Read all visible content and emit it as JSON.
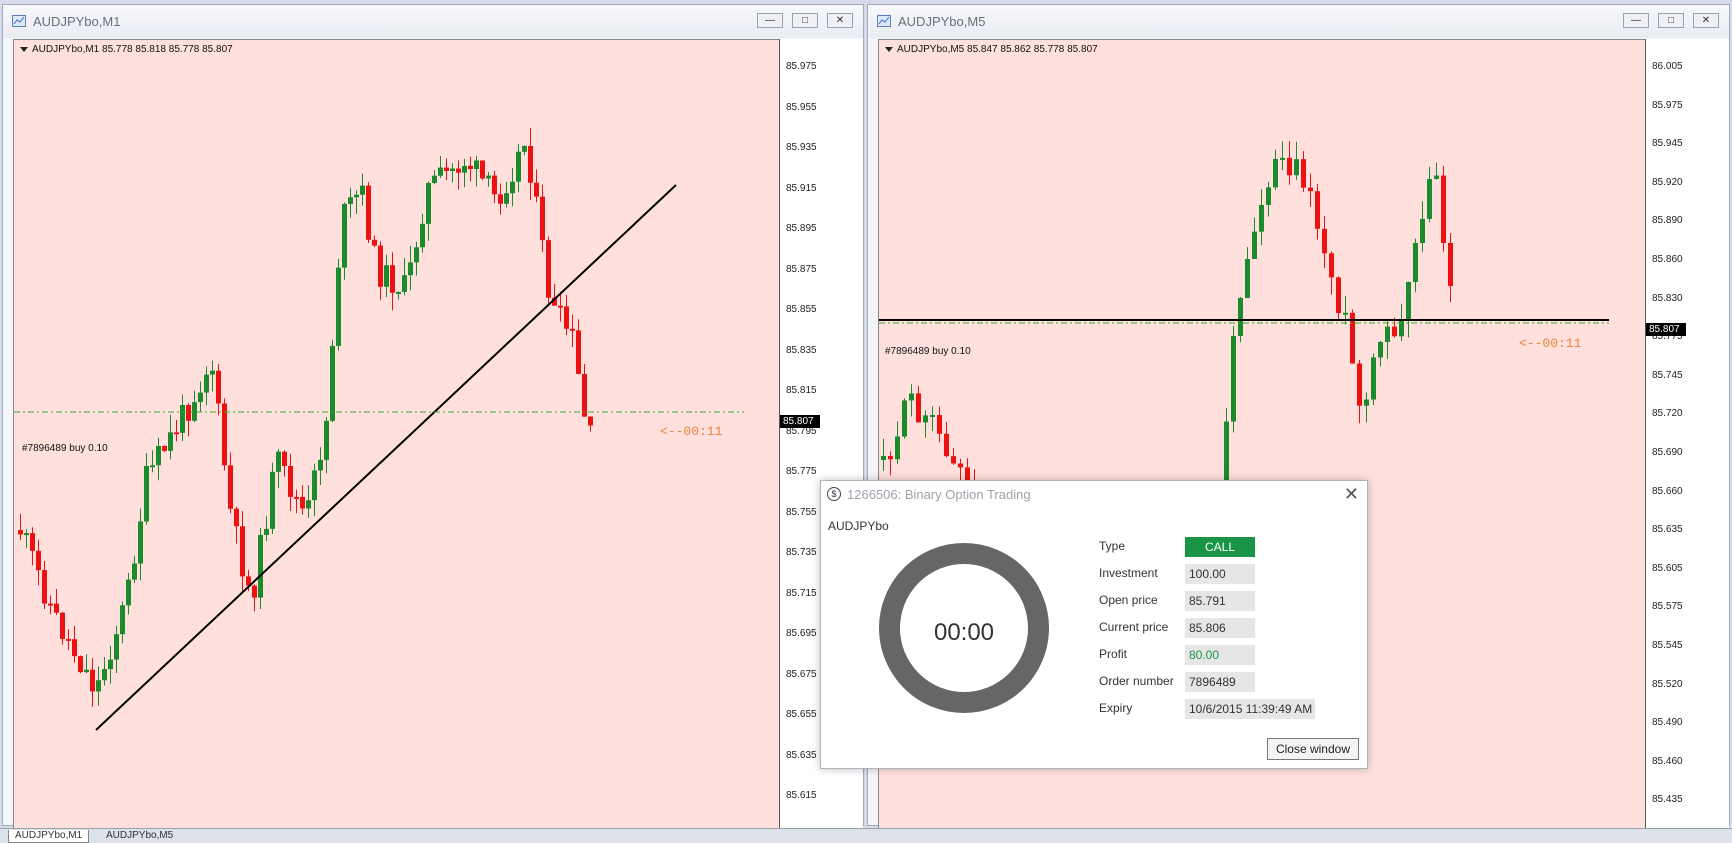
{
  "windows": [
    {
      "title": "AUDJPYbo,M1",
      "symbol_info": "AUDJPYbo,M1  85.778 85.818 85.778 85.807",
      "order_label": "#7896489 buy 0.10",
      "countdown": "<--00:11",
      "current_price": "85.807",
      "y_labels": [
        "85.975",
        "85.955",
        "85.935",
        "85.915",
        "85.895",
        "85.875",
        "85.855",
        "85.835",
        "85.815",
        "85.795",
        "85.775",
        "85.755",
        "85.735",
        "85.715",
        "85.695",
        "85.675",
        "85.655",
        "85.635",
        "85.615"
      ]
    },
    {
      "title": "AUDJPYbo,M5",
      "symbol_info": "AUDJPYbo,M5  85.847 85.862 85.778 85.807",
      "order_label": "#7896489 buy 0.10",
      "countdown": "<--00:11",
      "current_price": "85.807",
      "y_labels": [
        "86.005",
        "85.975",
        "85.945",
        "85.920",
        "85.890",
        "85.860",
        "85.830",
        "85.775",
        "85.745",
        "85.720",
        "85.690",
        "85.660",
        "85.635",
        "85.605",
        "85.575",
        "85.545",
        "85.520",
        "85.490",
        "85.460",
        "85.435"
      ]
    }
  ],
  "tabs": [
    "AUDJPYbo,M1",
    "AUDJPYbo,M5"
  ],
  "dialog": {
    "title": "1266506: Binary Option Trading",
    "symbol": "AUDJPYbo",
    "timer": "00:00",
    "fields": [
      {
        "label": "Type",
        "value": "CALL"
      },
      {
        "label": "Investment",
        "value": "100.00"
      },
      {
        "label": "Open price",
        "value": "85.791"
      },
      {
        "label": "Current price",
        "value": "85.806"
      },
      {
        "label": "Profit",
        "value": "80.00"
      },
      {
        "label": "Order number",
        "value": "7896489"
      },
      {
        "label": "Expiry",
        "value": "10/6/2015 11:39:49 AM"
      }
    ],
    "close_button": "Close window"
  },
  "colors": {
    "chart_bg": "#ffe0dd",
    "bull": "#1a8a2a",
    "bear": "#ee1111",
    "call_bg": "#1a9447",
    "countdown": "#e8833a"
  }
}
